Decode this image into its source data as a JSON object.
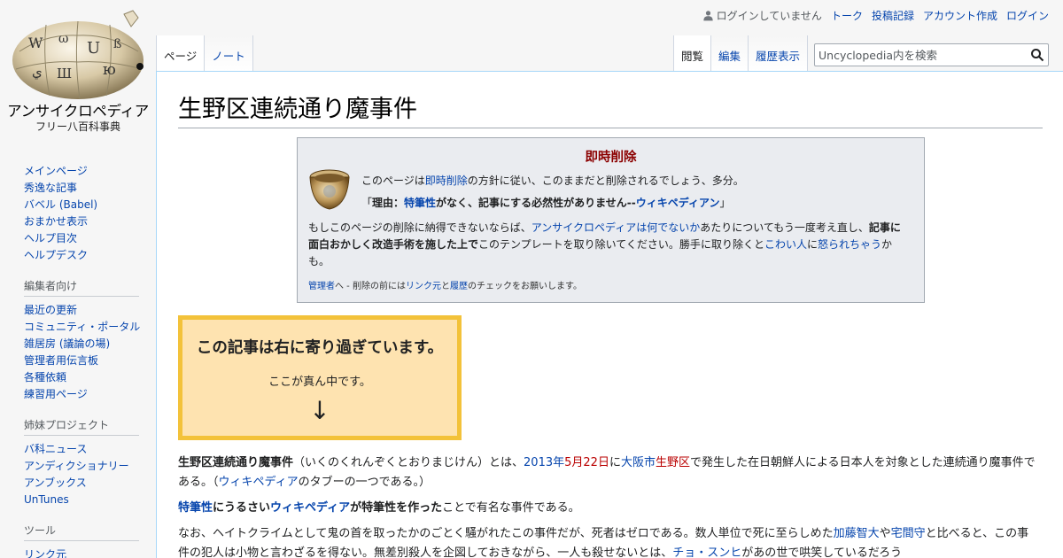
{
  "site": {
    "name": "アンサイクロペディア",
    "tagline": "フリー八百科事典",
    "logo_glyphs": [
      "W",
      "ω",
      "U",
      "ß",
      "ю",
      "Ш",
      "ي"
    ]
  },
  "personal_tools": {
    "not_logged_in": "ログインしていません",
    "talk": "トーク",
    "contributions": "投稿記録",
    "create_account": "アカウント作成",
    "login": "ログイン"
  },
  "tabs": {
    "page": "ページ",
    "talk": "ノート",
    "read": "閲覧",
    "edit": "編集",
    "history": "履歴表示"
  },
  "search": {
    "placeholder": "Uncyclopedia内を検索",
    "icon": "search-icon"
  },
  "sidebar": {
    "nav": [
      "メインページ",
      "秀逸な記事",
      "バベル (Babel)",
      "おまかせ表示",
      "ヘルプ目次",
      "ヘルプデスク"
    ],
    "editors_title": "編集者向け",
    "editors": [
      "最近の更新",
      "コミュニティ・ポータル",
      "雑居房 (議論の場)",
      "管理者用伝言板",
      "各種依頼",
      "練習用ページ"
    ],
    "sister_title": "姉妹プロジェクト",
    "sister": [
      "バ科ニュース",
      "アンディクショナリー",
      "アンブックス",
      "UnTunes"
    ],
    "tools_title": "ツール",
    "tools": [
      "リンク元"
    ]
  },
  "article": {
    "title": "生野区連続通り魔事件"
  },
  "deletion_box": {
    "title": "即時削除",
    "line1_pre": "このページは",
    "line1_link": "即時削除",
    "line1_post": "の方針に従い、このままだと削除されるでしょう、多分。",
    "line2_open": "「",
    "line2_reason": "理由：",
    "line2_link1": "特筆性",
    "line2_mid": "がなく、記事にする必然性がありません--",
    "line2_link2": "ウィキペディアン",
    "line2_close": "」",
    "para_pre": "もしこのページの削除に納得できないならば、",
    "para_link1": "アンサイクロペディアは何でないか",
    "para_mid1": "あたりについてもう一度考え直し、",
    "para_bold": "記事に面白おかしく改造手術を施した上で",
    "para_mid2": "このテンプレートを取り除いてください。勝手に取り除くと",
    "para_link2": "こわい人",
    "para_mid3": "に",
    "para_link3": "怒られちゃう",
    "para_post": "かも。",
    "note_link1": "管理者",
    "note_mid1": "へ - 削除の前には",
    "note_link2": "リンク元",
    "note_mid2": "と",
    "note_link3": "履歴",
    "note_post": "のチェックをお願いします。"
  },
  "yellow_box": {
    "title": "この記事は右に寄り過ぎています。",
    "sub": "ここが真ん中です。",
    "arrow": "↓"
  },
  "body": {
    "p1_bold": "生野区連続通り魔事件",
    "p1_a": "（いくのくれんぞくとおりまじけん）とは、",
    "p1_year": "2013年",
    "p1_date": "5月22日",
    "p1_b": "に",
    "p1_city": "大阪市",
    "p1_ward": "生野区",
    "p1_c": "で発生した在日朝鮮人による日本人を対象とした連続通り魔事件である。（",
    "p1_wp": "ウィキペディア",
    "p1_d": "のタブーの一つである。）",
    "p2_link1": "特筆性",
    "p2_bold1": "にうるさい",
    "p2_link2": "ウィキペディア",
    "p2_bold2": "が特筆性を作った",
    "p2_post": "ことで有名な事件である。",
    "p3_a": "なお、ヘイトクライムとして鬼の首を取ったかのごとく騒がれたこの事件だが、死者はゼロである。数人単位で死に至らしめた",
    "p3_link1": "加藤智大",
    "p3_b": "や",
    "p3_link2": "宅間守",
    "p3_c": "と比べると、この事件の犯人は小物と言わざるを得ない。無差別殺人を企図しておきながら、一人も殺せないとは、",
    "p3_link3": "チョ・スンヒ",
    "p3_d": "があの世で哄笑しているだろう"
  },
  "colors": {
    "link": "#0645ad",
    "redlink": "#ba0000",
    "yellow_border": "#f3c23a",
    "yellow_bg": "#fee3b0",
    "delbox_bg": "#eaecf0"
  }
}
